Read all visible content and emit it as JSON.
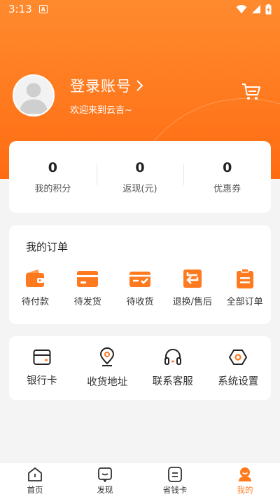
{
  "status_bar": {
    "time": "3:13",
    "notification_letter": "A"
  },
  "profile": {
    "login_label": "登录账号",
    "welcome": "欢迎来到云吉~"
  },
  "stats": [
    {
      "value": "0",
      "label": "我的积分"
    },
    {
      "value": "0",
      "label": "返现(元)"
    },
    {
      "value": "0",
      "label": "优惠券"
    }
  ],
  "orders": {
    "title": "我的订单",
    "items": [
      {
        "label": "待付款",
        "icon": "wallet-icon"
      },
      {
        "label": "待发货",
        "icon": "card-box-icon"
      },
      {
        "label": "待收货",
        "icon": "box-check-icon"
      },
      {
        "label": "退换/售后",
        "icon": "return-icon"
      },
      {
        "label": "全部订单",
        "icon": "clipboard-icon"
      }
    ]
  },
  "tools": [
    {
      "label": "银行卡",
      "icon": "bank-card-icon"
    },
    {
      "label": "收货地址",
      "icon": "location-pin-icon"
    },
    {
      "label": "联系客服",
      "icon": "headset-icon"
    },
    {
      "label": "系统设置",
      "icon": "settings-hex-icon"
    }
  ],
  "tabbar": [
    {
      "label": "首页",
      "icon": "home-icon",
      "active": false
    },
    {
      "label": "发现",
      "icon": "discover-icon",
      "active": false
    },
    {
      "label": "省钱卡",
      "icon": "card-icon",
      "active": false
    },
    {
      "label": "我的",
      "icon": "profile-icon",
      "active": true
    }
  ],
  "colors": {
    "accent": "#ff7a1f",
    "header_top": "#ff8a2e",
    "background": "#f4f4f4"
  }
}
